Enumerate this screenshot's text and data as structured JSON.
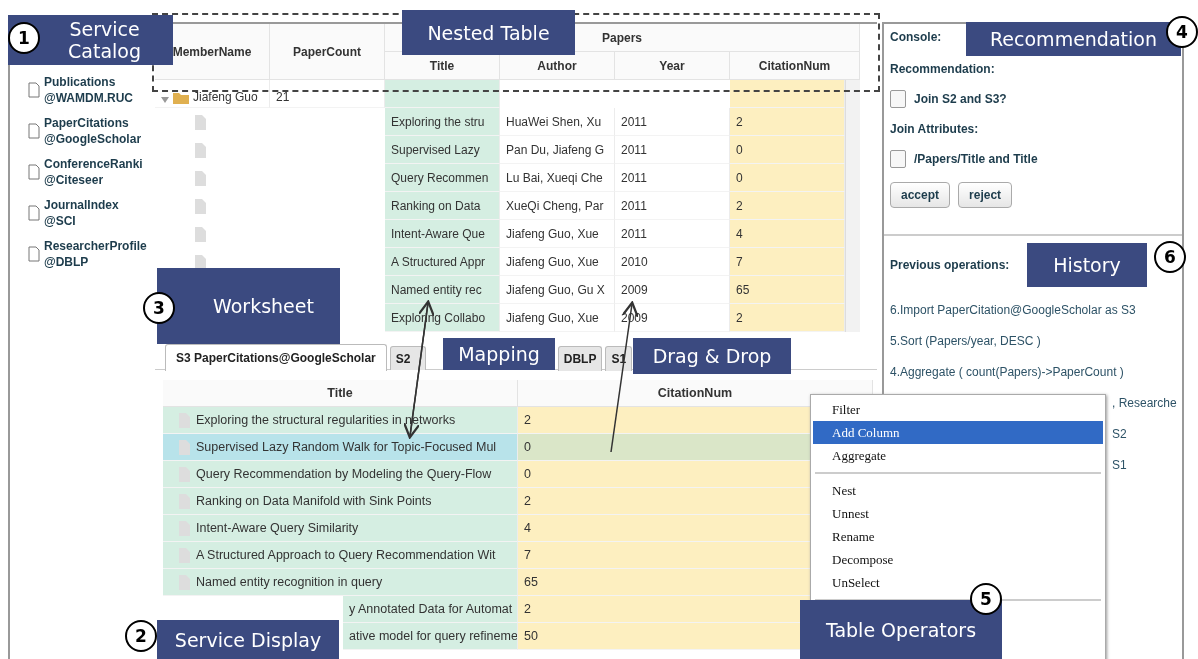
{
  "catalog": {
    "items": [
      {
        "name": "Publications",
        "source": "@WAMDM.RUC"
      },
      {
        "name": "PaperCitations",
        "source": "@GoogleScholar"
      },
      {
        "name": "ConferenceRanki",
        "source": "@Citeseer"
      },
      {
        "name": "JournalIndex",
        "source": "@SCI"
      },
      {
        "name": "ResearcherProfile",
        "source": "@DBLP"
      }
    ]
  },
  "nested_table": {
    "columns": [
      "MemberName",
      "PaperCount"
    ],
    "group": "Papers",
    "group_columns": [
      "Title",
      "Author",
      "Year",
      "CitationNum"
    ],
    "member": {
      "name": "Jiafeng Guo",
      "count": "21",
      "expanded": true
    },
    "rows": [
      [
        "Exploring the stru",
        "HuaWei Shen, Xu",
        "2011",
        "2"
      ],
      [
        "Supervised Lazy",
        "Pan Du, Jiafeng G",
        "2011",
        "0"
      ],
      [
        "Query Recommen",
        "Lu Bai, Xueqi Che",
        "2011",
        "0"
      ],
      [
        "Ranking on Data",
        "XueQi Cheng, Par",
        "2011",
        "2"
      ],
      [
        "Intent-Aware Que",
        "Jiafeng Guo, Xue",
        "2011",
        "4"
      ],
      [
        "A Structured Appr",
        "Jiafeng Guo, Xue",
        "2010",
        "7"
      ],
      [
        "Named entity rec",
        "Jiafeng Guo, Gu X",
        "2009",
        "65"
      ],
      [
        "Exploring Collabo",
        "Jiafeng Guo, Xue",
        "2009",
        "2"
      ]
    ]
  },
  "tabs": [
    {
      "label": "S3  PaperCitations@GoogleScholar",
      "selected": true
    },
    {
      "label": "S2",
      "selected": false
    },
    {
      "label": "DBLP",
      "selected": false
    },
    {
      "label": "S1",
      "selected": false
    }
  ],
  "table": {
    "columns": [
      "Title",
      "CitationNum"
    ],
    "rows": [
      {
        "title": "Exploring the structural regularities in networks",
        "citations": "2",
        "selected": false,
        "kind": "full"
      },
      {
        "title": "Supervised Lazy Random Walk for Topic-Focused Mul",
        "citations": "0",
        "selected": true,
        "kind": "full"
      },
      {
        "title": "Query Recommendation by Modeling the Query-Flow",
        "citations": "0",
        "selected": false,
        "kind": "full"
      },
      {
        "title": "Ranking on Data Manifold with Sink Points",
        "citations": "2",
        "selected": false,
        "kind": "full"
      },
      {
        "title": "Intent-Aware Query Similarity",
        "citations": "4",
        "selected": false,
        "kind": "full"
      },
      {
        "title": "A Structured Approach to Query Recommendation Wit",
        "citations": "7",
        "selected": false,
        "kind": "full"
      },
      {
        "title": "Named entity recognition in query",
        "citations": "65",
        "selected": false,
        "kind": "full"
      },
      {
        "title": "y Annotated Data for Automat",
        "citations": "2",
        "selected": false,
        "kind": "covered"
      },
      {
        "title": "ative model for query refineme",
        "citations": "50",
        "selected": false,
        "kind": "covered"
      }
    ]
  },
  "console": {
    "title": "Console:",
    "recommendation_label": "Recommendation:",
    "suggestion": {
      "label": "Join S2 and S3?",
      "checked": false
    },
    "attributes_label": "Join Attributes:",
    "attribute": {
      "label": "/Papers/Title and Title",
      "checked": false
    },
    "buttons": [
      "accept",
      "reject"
    ]
  },
  "history": {
    "title": "Previous operations:",
    "items": [
      {
        "text": "6.Import PaperCitation@GoogleScholar as S3",
        "kind": "full"
      },
      {
        "text": "5.Sort (Papers/year, DESC )",
        "kind": "full"
      },
      {
        "text": "4.Aggregate ( count(Papers)->PaperCount )",
        "kind": "full"
      },
      {
        "text": ", Researche",
        "kind": "covered"
      },
      {
        "text": "S2",
        "kind": "covered"
      },
      {
        "text": "S1",
        "kind": "covered"
      }
    ]
  },
  "context_menu": {
    "groups": [
      [
        {
          "label": "Filter",
          "selected": false
        },
        {
          "label": "Add Column",
          "selected": true
        },
        {
          "label": "Aggregate",
          "selected": false
        }
      ],
      [
        {
          "label": "Nest",
          "selected": false
        },
        {
          "label": "Unnest",
          "selected": false
        },
        {
          "label": "Rename",
          "selected": false
        },
        {
          "label": "Decompose",
          "selected": false
        },
        {
          "label": "UnSelect",
          "selected": false
        }
      ]
    ]
  },
  "callouts": [
    {
      "number": "1",
      "label": "Service Catalog"
    },
    {
      "label": "Nested Table"
    },
    {
      "number": "4",
      "label": "Recommendation"
    },
    {
      "number": "3",
      "label": "Worksheet"
    },
    {
      "label": "Mapping"
    },
    {
      "label": "Drag & Drop"
    },
    {
      "number": "6",
      "label": "History"
    },
    {
      "number": "5",
      "label": "Table Operators"
    },
    {
      "number": "2",
      "label": "Service Display"
    }
  ]
}
